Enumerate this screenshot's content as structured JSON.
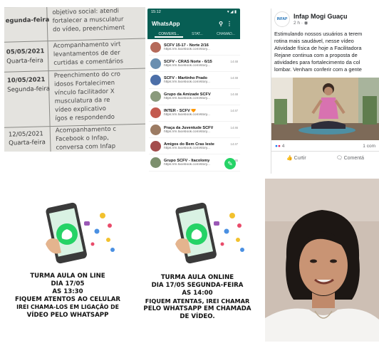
{
  "document": {
    "rows": [
      {
        "date": "egunda-feira",
        "lines": [
          "objetivo social: atendi",
          "fortalecer a musculatur",
          "do vídeo, preenchiment"
        ]
      },
      {
        "date": "05/05/2021",
        "day": "Quarta-feira",
        "lines": [
          "Acompanhamento virt",
          "levantamentos de der",
          "curtidas e comentários"
        ]
      },
      {
        "date": "10/05/2021",
        "day": "Segunda-feira",
        "lines": [
          "Preenchimento do cro",
          "idosos Fortalecimen",
          "vínculo facilitador X",
          "musculatura da re",
          "vídeo explicativo",
          "ígos e respondendo"
        ]
      },
      {
        "date": "12/05/2021",
        "day": "Quarta-feira",
        "lines": [
          "Acompanhamento c",
          "Facebook o Infap,",
          "conversa com Infap"
        ]
      }
    ]
  },
  "whatsapp": {
    "status_time": "15:12",
    "status_right": "▾ ◢ ▮",
    "title": "WhatsApp",
    "tabs": [
      "CONVERS...",
      "STAT...",
      "CHAMAD..."
    ],
    "chats": [
      {
        "name": "SCFV 15-17 - Norte 2/16",
        "time": "",
        "msg": "https://m.facebook.com/story...",
        "avatar": "#b56a5a"
      },
      {
        "name": "SCFV - CRAS Norte - 6/15",
        "time": "14:48",
        "msg": "https://m.facebook.com/story...",
        "avatar": "#6a8fb0"
      },
      {
        "name": "SCFV - Martinho Prado",
        "time": "14:48",
        "msg": "https://m.facebook.com/story...",
        "avatar": "#4c6fa8"
      },
      {
        "name": "Grupo da Amizade SCFV",
        "time": "14:48",
        "msg": "https://m.facebook.com/story...",
        "avatar": "#8a9a7c"
      },
      {
        "name": "INTER - SCFV 🧡",
        "time": "14:47",
        "msg": "https://m.facebook.com/story...",
        "avatar": "#c35a4f"
      },
      {
        "name": "Praça da Juventude SCFV",
        "time": "14:46",
        "msg": "https://m.facebook.com/story...",
        "avatar": "#9c7b63"
      },
      {
        "name": "Amigos do Bem Cras leste",
        "time": "14:47",
        "msg": "https://m.facebook.com/story...",
        "avatar": "#a34d4d"
      },
      {
        "name": "Grupo SCFV - Itacolomy",
        "time": "14:45",
        "msg": "https://m.facebook.com/story...",
        "avatar": "#7c8f6d"
      },
      {
        "name": "🌷 Flores do Casagrande",
        "time": "14:46",
        "msg": "https://m.facebook.com/story...",
        "avatar": "#b88a9c"
      }
    ],
    "fab_icon": "message-icon"
  },
  "facebook": {
    "logo_text": "INFAP",
    "page_name": "Infap Mogi Guaçu",
    "meta": "2 h · ◉",
    "post_lines": [
      "Estimulando nossos usuários a terem",
      "rotina mais saudável, nesse vídeo",
      "Atividade física de hoje a Facilitadora",
      "Rejane continua com a proposta de",
      "atividades para fortalecimento da col",
      "lombar. Venham conferir com a gente"
    ],
    "reaction_count": "4",
    "comment_count": "1 com",
    "like_label": "Curtir",
    "comment_label": "Comentá"
  },
  "flyer1": {
    "lines": [
      "TURMA AULA ON LINE",
      "DIA 17/05",
      "AS 13:30",
      "FIQUEM ATENTOS AO CELULAR",
      "IREI CHAMA-LOS EM LIGAÇÃO DE",
      "VÍDEO PELO WHATSAPP"
    ]
  },
  "flyer2": {
    "lines": [
      "TURMA AULA ONLINE",
      "DIA 17/05 SEGUNDA-FEIRA",
      "AS 14:00",
      "FIQUEM ATENTAS, IREI CHAMAR",
      "PELO WHATSAPP EM CHAMADA",
      "DE VÍDEO."
    ]
  }
}
